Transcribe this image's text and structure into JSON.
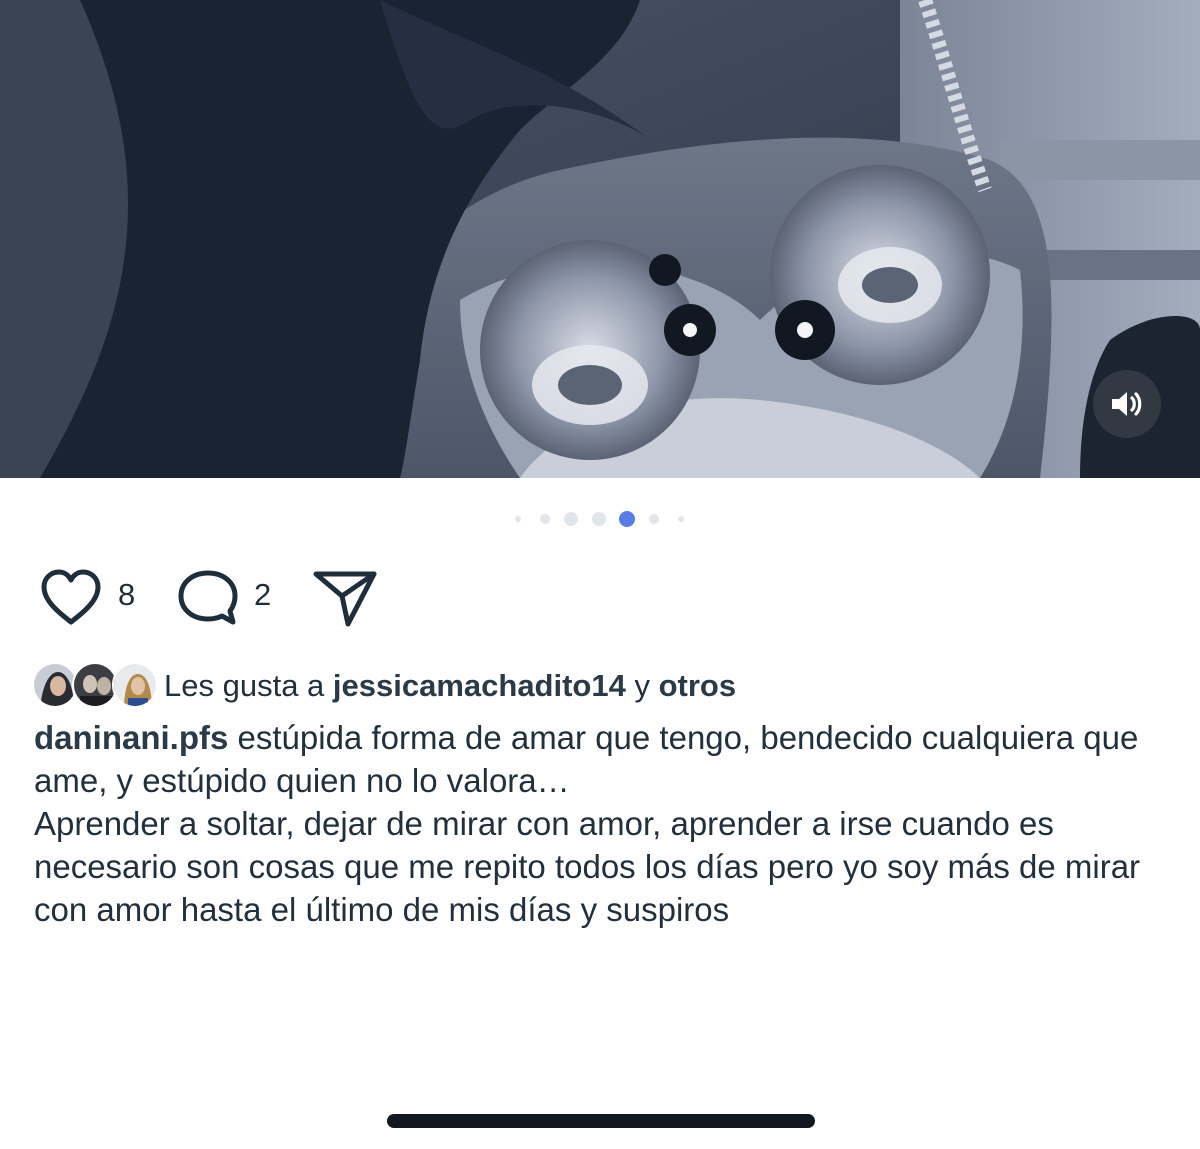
{
  "media": {
    "sound_icon": "speaker-volume-icon",
    "carousel": {
      "count": 7,
      "active_index": 4
    }
  },
  "actions": {
    "like_icon": "heart-icon",
    "like_count": "8",
    "comment_icon": "comment-bubble-icon",
    "comment_count": "2",
    "share_icon": "send-icon"
  },
  "likes": {
    "prefix": "Les gusta a ",
    "user": "jessicamachadito14",
    "joiner": " y ",
    "others": "otros"
  },
  "caption": {
    "username": "daninani.pfs",
    "text": " estúpida forma de amar que tengo, bendecido cualquiera que ame, y estúpido quien no lo valora…",
    "paragraph": "Aprender a soltar, dejar de mirar con amor, aprender a irse cuando es necesario son cosas que me repito todos los días pero yo soy más de mirar con amor hasta el último de mis días y suspiros"
  },
  "colors": {
    "text": "#22303d",
    "active_dot": "#5b7be6",
    "inactive_dot": "#e1e5ec",
    "home_indicator": "#111820"
  }
}
